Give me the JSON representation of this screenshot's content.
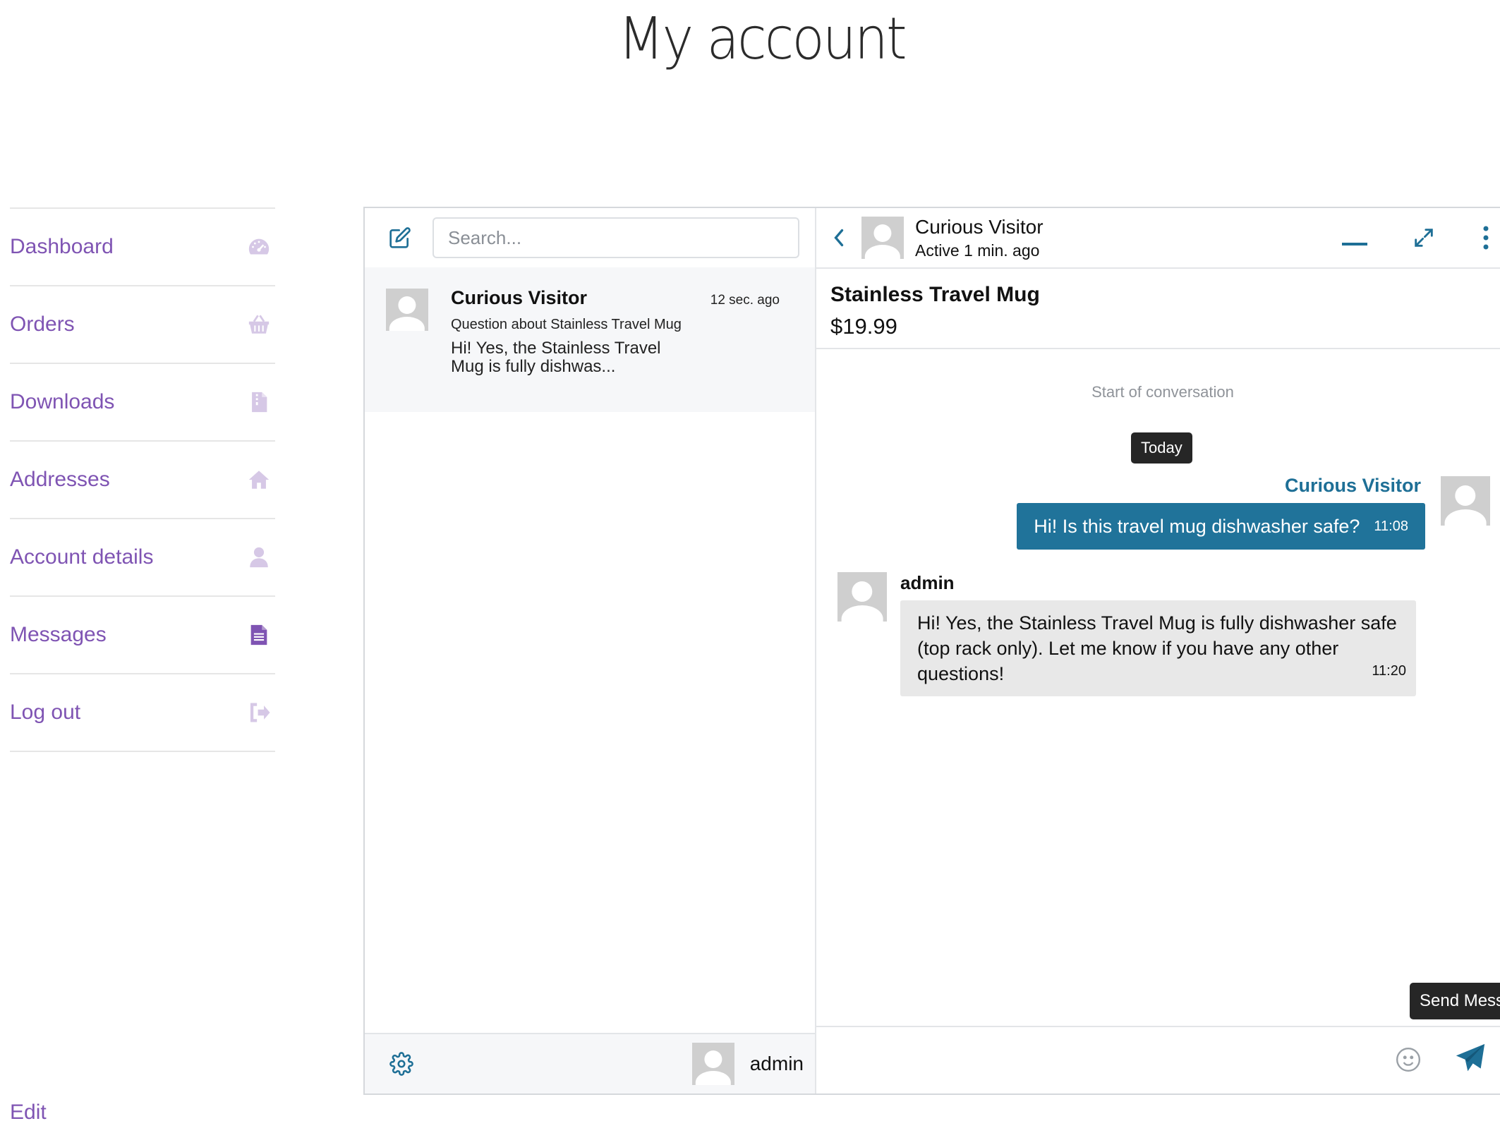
{
  "page": {
    "title": "My account"
  },
  "account_nav": {
    "items": [
      {
        "label": "Dashboard",
        "icon": "dashboard-icon"
      },
      {
        "label": "Orders",
        "icon": "basket-icon"
      },
      {
        "label": "Downloads",
        "icon": "file-archive-icon"
      },
      {
        "label": "Addresses",
        "icon": "home-icon"
      },
      {
        "label": "Account details",
        "icon": "user-icon"
      },
      {
        "label": "Messages",
        "icon": "document-icon"
      },
      {
        "label": "Log out",
        "icon": "logout-icon"
      }
    ],
    "edit_label": "Edit"
  },
  "messenger": {
    "search": {
      "placeholder": "Search..."
    },
    "threads": [
      {
        "name": "Curious Visitor",
        "time": "12 sec. ago",
        "subject": "Question about Stainless Travel Mug",
        "preview": "Hi! Yes, the Stainless Travel Mug is fully dishwas..."
      }
    ],
    "current_user": {
      "name": "admin"
    },
    "chat": {
      "contact_name": "Curious Visitor",
      "contact_status": "Active 1 min. ago",
      "product": {
        "name": "Stainless Travel Mug",
        "price": "$19.99"
      },
      "start_label": "Start of conversation",
      "day_label": "Today",
      "messages": [
        {
          "sender": "Curious Visitor",
          "text": "Hi! Is this travel mug dishwasher safe?",
          "time": "11:08",
          "direction": "out"
        },
        {
          "sender": "admin",
          "text": "Hi! Yes, the Stainless Travel Mug is fully dishwasher safe (top rack only). Let me know if you have any other questions!",
          "time": "11:20",
          "direction": "in"
        }
      ],
      "send_tooltip": "Send Mess"
    }
  },
  "colors": {
    "accent_purple": "#7f54b3",
    "accent_blue": "#20739a",
    "nav_icon": "#d6c8e6"
  }
}
